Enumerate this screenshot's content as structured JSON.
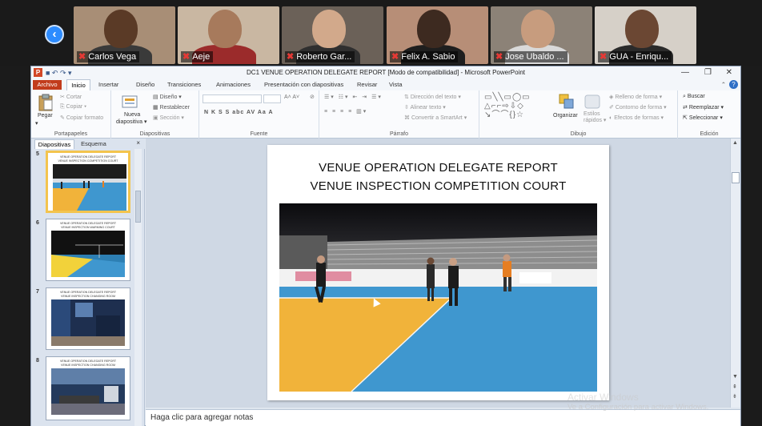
{
  "video_strip": {
    "participants": [
      {
        "name": "Carlos Vega",
        "bg": "#a88e76",
        "skin": "#5a3a26",
        "shirt": "#3a3a3a"
      },
      {
        "name": "Aeje",
        "bg": "#c9b7a2",
        "skin": "#a77a5c",
        "shirt": "#9b2b2b"
      },
      {
        "name": "Roberto Gar...",
        "bg": "#6b6158",
        "skin": "#d2a98b",
        "shirt": "#2f2f2f"
      },
      {
        "name": "Felix A. Sabio",
        "bg": "#b78e77",
        "skin": "#3d2a20",
        "shirt": "#1e1e1e"
      },
      {
        "name": "Jose Ubaldo ...",
        "bg": "#8c8277",
        "skin": "#c79c7e",
        "shirt": "#d9d9d9"
      },
      {
        "name": "GUA - Enriqu...",
        "bg": "#d6d0c8",
        "skin": "#6b4733",
        "shirt": "#2a2a2a"
      }
    ]
  },
  "window": {
    "title": "DC1 VENUE OPERATION DELEGATE REPORT [Modo de compatibilidad] - Microsoft PowerPoint"
  },
  "ribbon_tabs": [
    "Archivo",
    "Inicio",
    "Insertar",
    "Diseño",
    "Transiciones",
    "Animaciones",
    "Presentación con diapositivas",
    "Revisar",
    "Vista"
  ],
  "ribbon": {
    "portapapeles": {
      "pegar": "Pegar",
      "cortar": "Cortar",
      "copiar": "Copiar",
      "copiar_formato": "Copiar formato",
      "group": "Portapapeles"
    },
    "diapositivas": {
      "nueva": "Nueva",
      "diapositiva": "diapositiva",
      "diseno": "Diseño",
      "restablecer": "Restablecer",
      "seccion": "Sección",
      "group": "Diapositivas"
    },
    "fuente": {
      "group": "Fuente",
      "buttons": "N  K  S  S  abc  AV  Aa    A"
    },
    "parrafo": {
      "group": "Párrafo",
      "direccion": "Dirección del texto",
      "alinear": "Alinear texto",
      "convertir": "Convertir a SmartArt"
    },
    "dibujo": {
      "group": "Dibujo",
      "organizar": "Organizar",
      "estilos": "Estilos",
      "rapidos": "rápidos",
      "relleno": "Relleno de forma",
      "contorno": "Contorno de forma",
      "efectos": "Efectos de formas"
    },
    "edicion": {
      "group": "Edición",
      "buscar": "Buscar",
      "reemplazar": "Reemplazar",
      "seleccionar": "Seleccionar"
    }
  },
  "slides_pane": {
    "tab_diapositivas": "Diapositivas",
    "tab_esquema": "Esquema",
    "close": "×",
    "thumbnails": [
      {
        "num": "5",
        "title": "VENUE OPERATION DELEGATE REPORT\nVENUE INSPECTION COMPETITION COURT",
        "selected": true
      },
      {
        "num": "6",
        "title": "VENUE OPERATION DELEGATE REPORT\nVENUE INSPECTION WARMING COURT",
        "selected": false
      },
      {
        "num": "7",
        "title": "VENUE OPERATION DELEGATE REPORT\nVENUE INSPECTION CHANGING ROOM",
        "selected": false
      },
      {
        "num": "8",
        "title": "VENUE OPERATION DELEGATE REPORT\nVENUE INSPECTION CHANGING ROOM",
        "selected": false
      }
    ]
  },
  "slide": {
    "title_line1": "VENUE OPERATION DELEGATE REPORT",
    "title_line2": "VENUE INSPECTION  COMPETITION COURT"
  },
  "notes": {
    "placeholder": "Haga clic para agregar notas"
  },
  "watermark": {
    "title": "Activar Windows",
    "text": "Ve a Configuración para activar Windows."
  },
  "colors": {
    "court_blue": "#3f97cf",
    "court_yellow": "#f1b33a",
    "ppt_red": "#c23c1c",
    "zoom_blue": "#2d8cff"
  }
}
